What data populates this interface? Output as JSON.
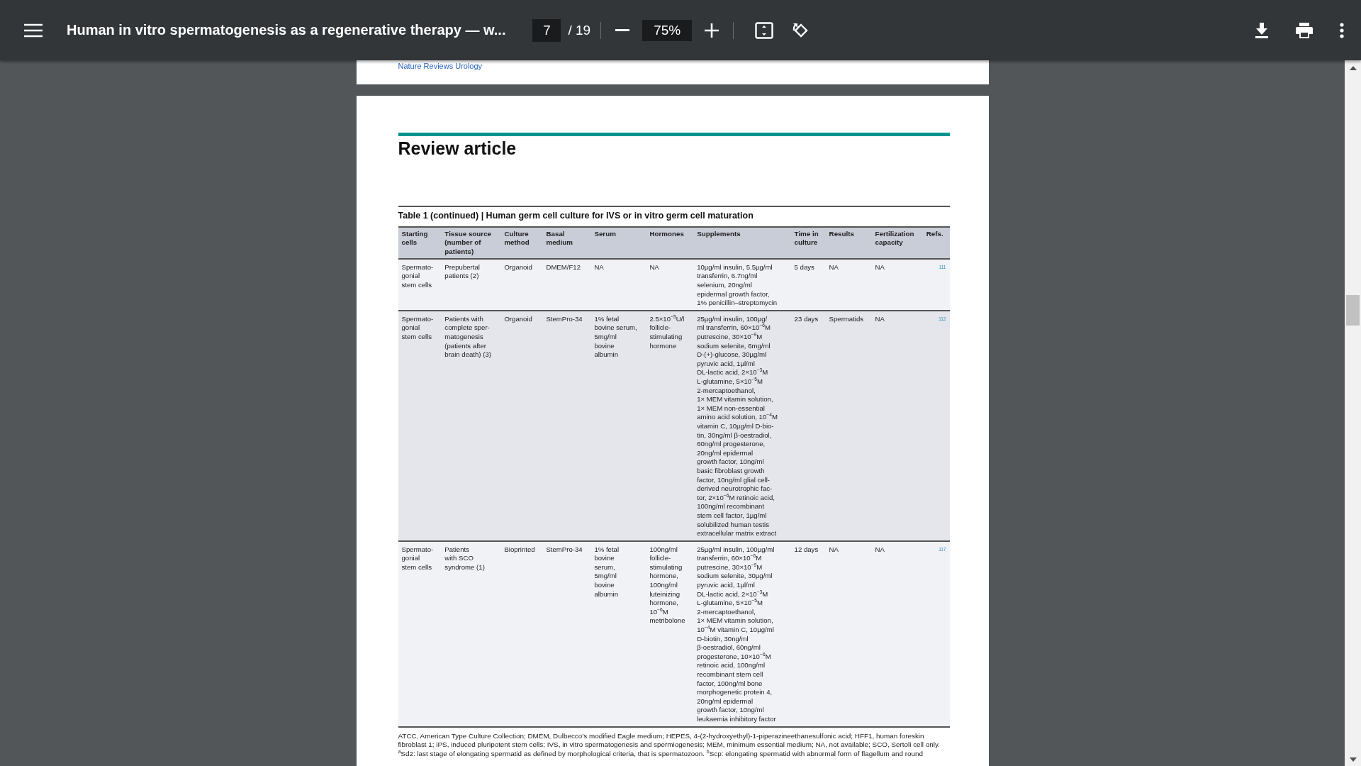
{
  "toolbar": {
    "title": "Human in vitro spermatogenesis as a regenerative therapy — w...",
    "page": "7",
    "page_count": "/ 19",
    "zoom": "75%"
  },
  "previous_page": {
    "footer_link": "Nature Reviews Urology"
  },
  "page": {
    "section": "Review article",
    "table": {
      "caption": "Table 1 (continued) | Human germ cell culture for IVS or in vitro germ cell maturation",
      "columns": [
        "Starting\ncells",
        "Tissue source\n(number of\npatients)",
        "Culture\nmethod",
        "Basal\nmedium",
        "Serum",
        "Hormones",
        "Supplements",
        "Time in\nculture",
        "Results",
        "Fertilization\ncapacity",
        "Refs."
      ],
      "rows": [
        [
          "Spermato-\ngonial\nstem cells",
          "Prepubertal\npatients (2)",
          "Organoid",
          "DMEM/F12",
          "NA",
          "NA",
          "10µg/ml insulin, 5.5µg/ml\ntransferrin, 6.7ng/ml\nselenium, 20ng/ml\nepidermal growth factor,\n1% penicillin–streptomycin",
          "5 days",
          "NA",
          "NA",
          "111"
        ],
        [
          "Spermato-\ngonial\nstem cells",
          "Patients with\ncomplete sper-\nmatogenesis\n(patients after\nbrain death) (3)",
          "Organoid",
          "StemPro-34",
          "1% fetal\nbovine serum,\n5mg/ml\nbovine\nalbumin",
          "2.5×10$^{−5}$U/l\nfollicle-\nstimulating\nhormone",
          "25µg/ml insulin, 100µg/\nml transferrin, 60×10$^{−6}$M\nputrescine, 30×10$^{−9}$M\nsodium selenite, 6mg/ml\nD-(+)-glucose, 30µg/ml\npyruvic acid, 1µl/ml\nDL-lactic acid, 2×10$^{−3}$M\nL-glutamine, 5×10$^{−5}$M\n2-mercaptoethanol,\n1× MEM vitamin solution,\n1× MEM non-essential\namino acid solution, 10$^{−4}$M\nvitamin C, 10µg/ml D-bio-\ntin, 30ng/ml β-oestradiol,\n60ng/ml progesterone,\n20ng/ml epidermal\ngrowth factor, 10ng/ml\nbasic fibroblast growth\nfactor, 10ng/ml glial cell-\nderived neurotrophic fac-\ntor, 2×10$^{−6}$M retinoic acid,\n100ng/ml recombinant\nstem cell factor, 1µg/ml\nsolubilized human testis\nextracellular matrix extract",
          "23 days",
          "Spermatids",
          "NA",
          "112"
        ],
        [
          "Spermato-\ngonial\nstem cells",
          "Patients\nwith SCO\nsyndrome (1)",
          "Bioprinted",
          "StemPro-34",
          "1% fetal\nbovine\nserum,\n5mg/ml\nbovine\nalbumin",
          "100ng/ml\nfollicle-\nstimulating\nhormone,\n100ng/ml\nluteinizing\nhormone,\n10$^{−6}$M\nmetribolone",
          "25µg/ml insulin, 100µg/ml\ntransferrin, 60×10$^{−6}$M\nputrescine, 30×10$^{−9}$M\nsodium selenite, 30µg/ml\npyruvic acid, 1µl/ml\nDL-lactic acid, 2×10$^{−3}$M\nL-glutamine, 5×10$^{−5}$M\n2-mercaptoethanol,\n1× MEM vitamin solution,\n10$^{−4}$M vitamin C, 10µg/ml\nD-biotin, 30ng/ml\nβ-oestradiol, 60ng/ml\nprogesterone, 10×10$^{−6}$M\nretinoic acid, 100ng/ml\nrecombinant stem cell\nfactor, 100ng/ml bone\nmorphogenetic protein 4,\n20ng/ml epidermal\ngrowth factor, 10ng/ml\nleukaemia inhibitory factor",
          "12 days",
          "NA",
          "NA",
          "117"
        ]
      ]
    },
    "footnote": "ATCC, American Type Culture Collection; DMEM, Dulbecco’s modified Eagle medium; HEPES, 4-(2-hydroxyethyl)-1-piperazineethanesulfonic acid; HFF1, human foreskin\nfibroblast 1; iPS, induced pluripotent stem cells; IVS, in vitro spermatogenesis and spermiogenesis; MEM, minimum essential medium; NA, not available; SCO, Sertoli cell only.\n$^{a}$Sd2: last stage of elongating spermatid as defined by morphological criteria, that is spermatozoon. $^{b}$Scp: elongating spermatid with abnormal form of flagellum and round"
  }
}
